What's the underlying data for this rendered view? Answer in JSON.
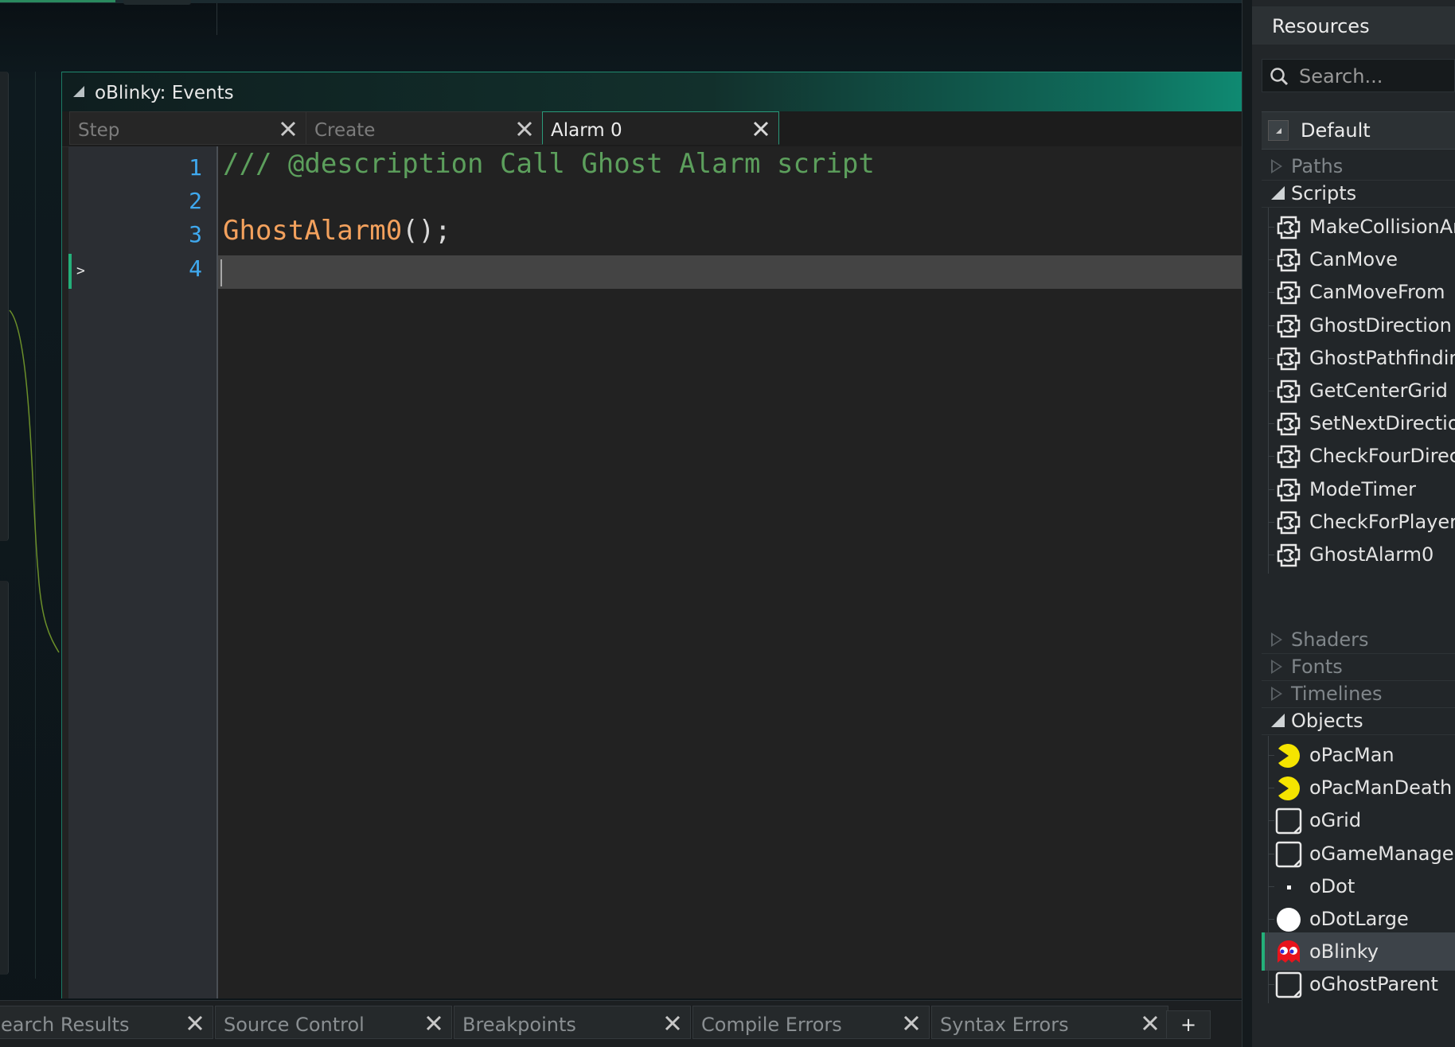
{
  "event_editor": {
    "title": "oBlinky: Events",
    "tabs": [
      {
        "label": "Step",
        "active": false
      },
      {
        "label": "Create",
        "active": false
      },
      {
        "label": "Alarm 0",
        "active": true
      }
    ],
    "code": {
      "line_numbers": [
        "1",
        "2",
        "3",
        "4"
      ],
      "line1_comment": "/// @description Call Ghost Alarm script",
      "line3_func": "GhostAlarm0",
      "line3_punc": "();",
      "current_line": 4
    }
  },
  "bottom_tabs": {
    "items": [
      "earch Results",
      "Source Control",
      "Breakpoints",
      "Compile Errors",
      "Syntax Errors"
    ],
    "add_label": "+"
  },
  "resources": {
    "title": "Resources",
    "search_placeholder": "Search...",
    "default_group": "Default",
    "groups": {
      "paths": "Paths",
      "scripts": "Scripts",
      "shaders": "Shaders",
      "fonts": "Fonts",
      "timelines": "Timelines",
      "objects": "Objects"
    },
    "scripts": [
      "MakeCollisionArr",
      "CanMove",
      "CanMoveFrom",
      "GhostDirection",
      "GhostPathfinding",
      "GetCenterGrid",
      "SetNextDirection",
      "CheckFourDirect",
      "ModeTimer",
      "CheckForPlayerK",
      "GhostAlarm0"
    ],
    "objects": [
      {
        "label": "oPacMan",
        "icon": "pacman-icon"
      },
      {
        "label": "oPacManDeath",
        "icon": "pacman-icon"
      },
      {
        "label": "oGrid",
        "icon": "empty-sprite-icon"
      },
      {
        "label": "oGameManager",
        "icon": "empty-sprite-icon"
      },
      {
        "label": "oDot",
        "icon": "dot-icon"
      },
      {
        "label": "oDotLarge",
        "icon": "large-dot-icon"
      },
      {
        "label": "oBlinky",
        "icon": "ghost-icon",
        "selected": true
      },
      {
        "label": "oGhostParent",
        "icon": "empty-sprite-icon"
      }
    ]
  },
  "colors": {
    "accent": "#24b07a",
    "comment": "#5c9f5c",
    "function": "#f3a15d",
    "line_number": "#3fa9ef"
  }
}
